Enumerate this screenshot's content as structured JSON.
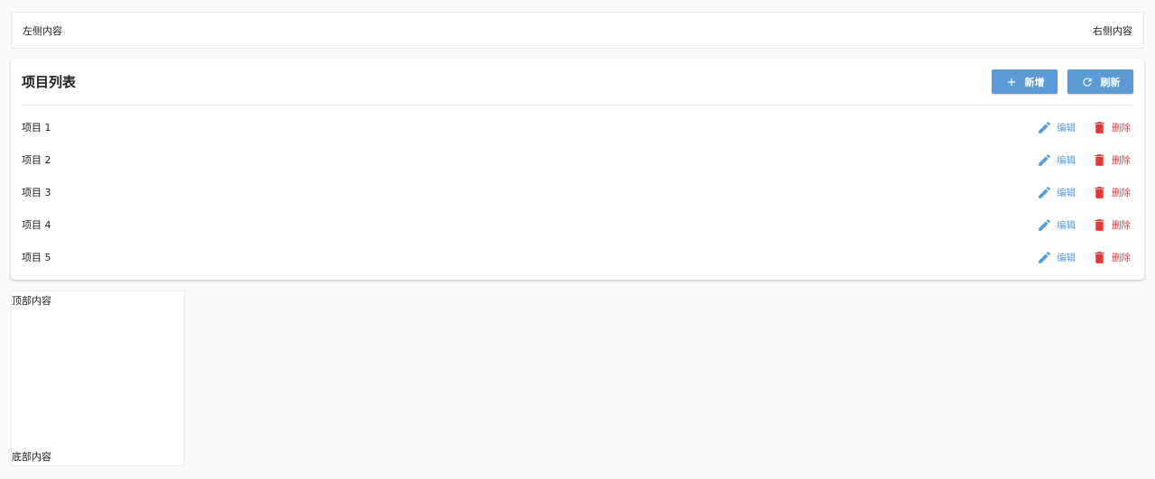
{
  "top_bar": {
    "left_text": "左侧内容",
    "right_text": "右侧内容"
  },
  "card": {
    "title": "项目列表",
    "add_label": "新增",
    "refresh_label": "刷新",
    "edit_label": "编辑",
    "delete_label": "删除",
    "items": [
      {
        "name": "项目 1"
      },
      {
        "name": "项目 2"
      },
      {
        "name": "项目 3"
      },
      {
        "name": "项目 4"
      },
      {
        "name": "项目 5"
      }
    ]
  },
  "side_box": {
    "top_text": "顶部内容",
    "bottom_text": "底部内容"
  },
  "colors": {
    "primary": "#5b9bd5",
    "danger": "#e53935"
  },
  "icons": {
    "add": "plus-icon",
    "refresh": "refresh-icon",
    "edit": "pencil-icon",
    "delete": "trash-icon"
  }
}
